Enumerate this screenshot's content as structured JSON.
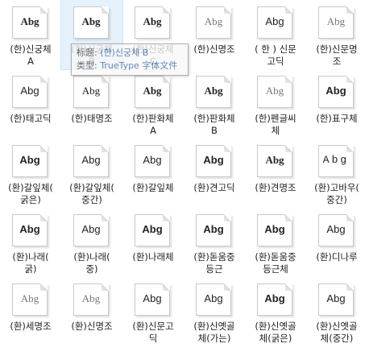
{
  "sample_text": "Abg",
  "tiles": [
    {
      "label": "(한)신궁체\nA",
      "style": "serif bold",
      "selected": false
    },
    {
      "label": "(한)신궁체\nB",
      "style": "serif bold",
      "selected": true
    },
    {
      "label": "(한)신궁체\nC",
      "style": "serif bold",
      "selected": false
    },
    {
      "label": "(한)신명조",
      "style": "serif light",
      "selected": false
    },
    {
      "label": "( 한 ) 신문\n고딕",
      "style": "sans",
      "selected": false
    },
    {
      "label": "(한)신문명\n조",
      "style": "serif light",
      "selected": false
    },
    {
      "label": "(한)태고딕",
      "style": "sans",
      "selected": false
    },
    {
      "label": "(한)태명조",
      "style": "serif",
      "selected": false
    },
    {
      "label": "(한)판화체\nA",
      "style": "serif bold",
      "selected": false
    },
    {
      "label": "(한)판화체\nB",
      "style": "serif bold",
      "selected": false
    },
    {
      "label": "(한)펜글씨\n체",
      "style": "serif light",
      "selected": false
    },
    {
      "label": "(한)표구체",
      "style": "sans bold",
      "selected": false
    },
    {
      "label": "(환)갈잎체(\n굵은)",
      "style": "sans bold",
      "selected": false
    },
    {
      "label": "(환)갈잎체(\n중간)",
      "style": "sans",
      "selected": false
    },
    {
      "label": "(환)갈잎체",
      "style": "sans",
      "selected": false
    },
    {
      "label": "(환)견고딕",
      "style": "sans bold",
      "selected": false
    },
    {
      "label": "(환)견명조",
      "style": "serif bold",
      "selected": false
    },
    {
      "label": "(환)고바우(\n중간)",
      "style": "mono wide",
      "selected": false
    },
    {
      "label": "(환)나래(\n굵)",
      "style": "sans bold",
      "selected": false
    },
    {
      "label": "(환)나래(\n중)",
      "style": "sans",
      "selected": false
    },
    {
      "label": "(환)나래체",
      "style": "sans bold",
      "selected": false
    },
    {
      "label": "(환)돋움중\n등근",
      "style": "sans bold",
      "selected": false
    },
    {
      "label": "(환)돋움중\n등근체",
      "style": "sans bold",
      "selected": false
    },
    {
      "label": "(환)디나루",
      "style": "sans",
      "selected": false
    },
    {
      "label": "(환)세명조",
      "style": "serif light",
      "selected": false
    },
    {
      "label": "(환)신명조",
      "style": "serif light",
      "selected": false
    },
    {
      "label": "(환)신문고\n딕",
      "style": "sans",
      "selected": false
    },
    {
      "label": "(환)신옛골\n체(가는)",
      "style": "sans",
      "selected": false
    },
    {
      "label": "(환)신옛골\n체(굵은)",
      "style": "sans bold",
      "selected": false
    },
    {
      "label": "(환)신옛골\n체(중간)",
      "style": "sans",
      "selected": false
    }
  ],
  "tooltip": {
    "title_key": "标题:",
    "title_value": "(한)신궁체 B",
    "type_key": "类型:",
    "type_value": "TrueType 字体文件"
  }
}
